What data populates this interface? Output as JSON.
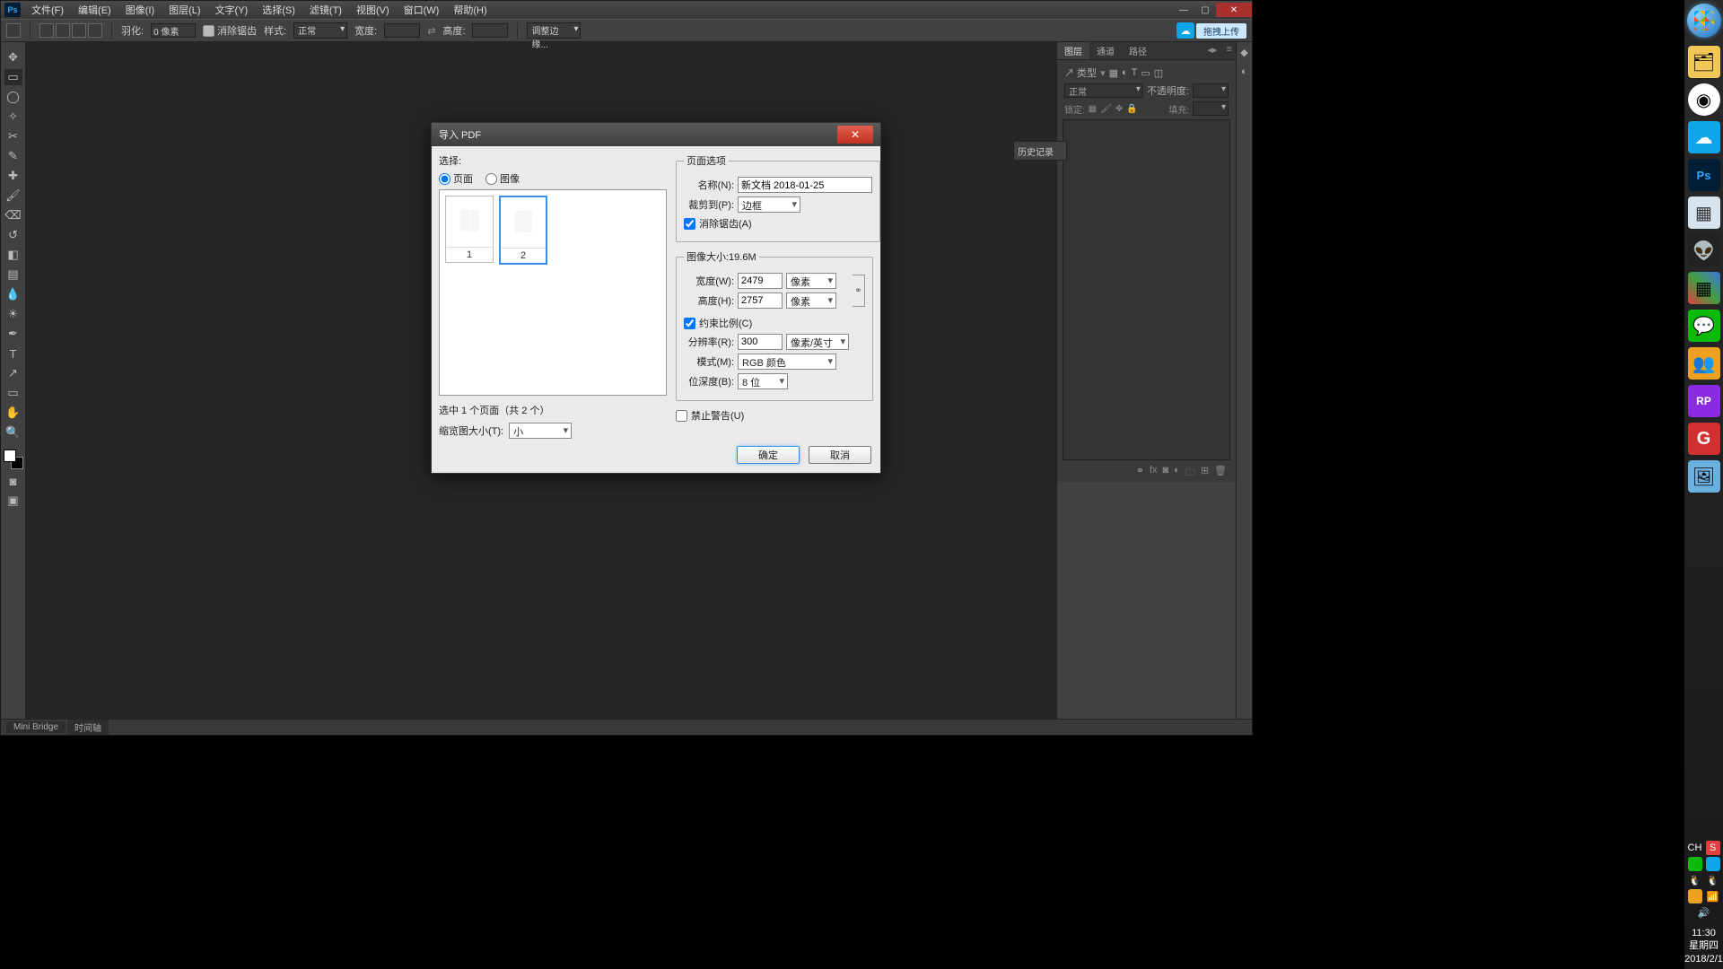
{
  "menu": [
    "文件(F)",
    "编辑(E)",
    "图像(I)",
    "图层(L)",
    "文字(Y)",
    "选择(S)",
    "滤镜(T)",
    "视图(V)",
    "窗口(W)",
    "帮助(H)"
  ],
  "optbar": {
    "feather_label": "羽化:",
    "feather_value": "0 像素",
    "antialias": "消除锯齿",
    "style_label": "样式:",
    "style_value": "正常",
    "width_label": "宽度:",
    "height_label": "高度:",
    "refine": "调整边缘...",
    "cloud": "拖拽上传"
  },
  "panels": {
    "tabs": [
      "图层",
      "通道",
      "路径"
    ],
    "kind_label": "↗ 类型",
    "blend": "正常",
    "opacity_label": "不透明度:",
    "lock_label": "锁定:",
    "fill_label": "填充:"
  },
  "history_label": "历史记录",
  "statusbar": {
    "tab1": "Mini Bridge",
    "tab2": "时间轴"
  },
  "dialog": {
    "title": "导入 PDF",
    "select_label": "选择:",
    "radio_page": "页面",
    "radio_image": "图像",
    "selected_info": "选中 1 个页面（共 2 个）",
    "thumbsize_label": "缩览图大小(T):",
    "thumbsize_value": "小",
    "pageopts": "页面选项",
    "name_label": "名称(N):",
    "name_value": "新文档 2018-01-25",
    "crop_label": "裁剪到(P):",
    "crop_value": "边框",
    "antialias_label": "消除锯齿(A)",
    "imagesize": "图像大小:19.6M",
    "width_label": "宽度(W):",
    "width_value": "2479",
    "height_label": "高度(H):",
    "height_value": "2757",
    "unit_px": "像素",
    "constrain": "约束比例(C)",
    "res_label": "分辨率(R):",
    "res_value": "300",
    "res_unit": "像素/英寸",
    "mode_label": "模式(M):",
    "mode_value": "RGB 颜色",
    "depth_label": "位深度(B):",
    "depth_value": "8 位",
    "suppress": "禁止警告(U)",
    "ok": "确定",
    "cancel": "取消"
  },
  "taskbar": {
    "lang": "CH",
    "time": "11:30",
    "day": "星期四",
    "date": "2018/2/1"
  },
  "icons": {
    "explorer": "#f3c757",
    "chrome": "#fff",
    "cloud": "#0ea5e9",
    "ps": "#001e36",
    "calc": "#d8e4f0",
    "alien": "#222",
    "blocks": "#3a7a3a",
    "wechat": "#09bb07",
    "qq": "#f0a020",
    "rp": "#8a2be2",
    "g": "#d03030",
    "photo": "#6ab0e0"
  }
}
